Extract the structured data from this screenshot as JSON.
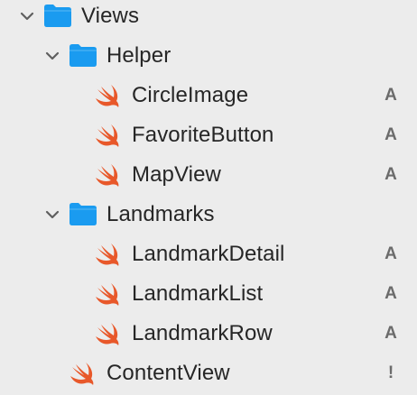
{
  "navigator": {
    "rows": [
      {
        "label": "Views",
        "status": "",
        "kind": "folder",
        "expanded": true
      },
      {
        "label": "Helper",
        "status": "",
        "kind": "folder",
        "expanded": true
      },
      {
        "label": "CircleImage",
        "status": "A",
        "kind": "swift-file"
      },
      {
        "label": "FavoriteButton",
        "status": "A",
        "kind": "swift-file"
      },
      {
        "label": "MapView",
        "status": "A",
        "kind": "swift-file"
      },
      {
        "label": "Landmarks",
        "status": "",
        "kind": "folder",
        "expanded": true
      },
      {
        "label": "LandmarkDetail",
        "status": "A",
        "kind": "swift-file"
      },
      {
        "label": "LandmarkList",
        "status": "A",
        "kind": "swift-file"
      },
      {
        "label": "LandmarkRow",
        "status": "A",
        "kind": "swift-file"
      },
      {
        "label": "ContentView",
        "status": "!",
        "kind": "swift-file"
      }
    ]
  },
  "colors": {
    "background": "#ececec",
    "folder": "#1a9bf0",
    "swift": "#e8582a",
    "text": "#262626",
    "status": "#6b6b6b",
    "chevron": "#5f5f5f"
  },
  "icons": {
    "folder": "folder-icon",
    "swift-file": "swift-file-icon",
    "disclosure": "chevron-down-icon"
  }
}
